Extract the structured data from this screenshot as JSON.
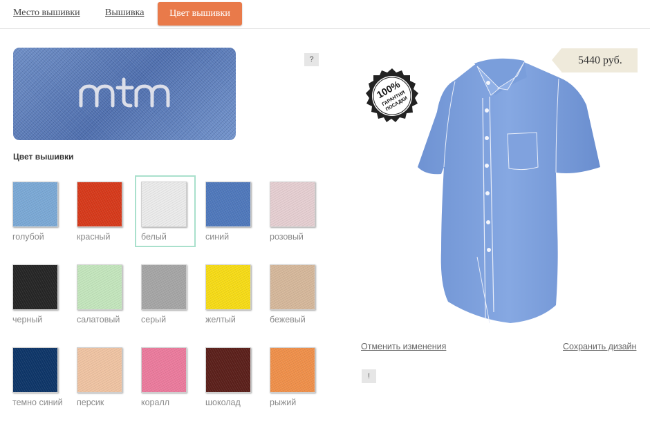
{
  "tabs": {
    "placement": "Место вышивки",
    "embroidery": "Вышивка",
    "color": "Цвет вышивки"
  },
  "preview": {
    "text": "mtm",
    "background": "#5b7bb9",
    "thread_color": "#e8e8ee"
  },
  "help_label": "?",
  "section_title": "Цвет вышивки",
  "swatches": [
    {
      "label": "голубой",
      "color": "#7ba9d6"
    },
    {
      "label": "красный",
      "color": "#d7391a"
    },
    {
      "label": "белый",
      "color": "#ececec"
    },
    {
      "label": "синий",
      "color": "#4f78bc"
    },
    {
      "label": "розовый",
      "color": "#e6cfd2"
    },
    {
      "label": "черный",
      "color": "#252525"
    },
    {
      "label": "салатовый",
      "color": "#c4e6bd"
    },
    {
      "label": "серый",
      "color": "#a6a6a6"
    },
    {
      "label": "желтый",
      "color": "#f7dc16"
    },
    {
      "label": "бежевый",
      "color": "#d6b89b"
    },
    {
      "label": "темно синий",
      "color": "#0d3568"
    },
    {
      "label": "персик",
      "color": "#f0c4a3"
    },
    {
      "label": "коралл",
      "color": "#ec7b9d"
    },
    {
      "label": "шоколад",
      "color": "#5b1f1a"
    },
    {
      "label": "рыжий",
      "color": "#f0904a"
    }
  ],
  "selected_swatch": "белый",
  "price": "5440 руб.",
  "badge": {
    "percent": "100%",
    "line1": "ГАРАНТИЯ",
    "line2": "ПОСАДКИ"
  },
  "shirt_color": "#7a9edb",
  "actions": {
    "cancel": "Отменить изменения",
    "save": "Сохранить дизайн",
    "info": "!"
  },
  "accent_color": "#e97a4a"
}
